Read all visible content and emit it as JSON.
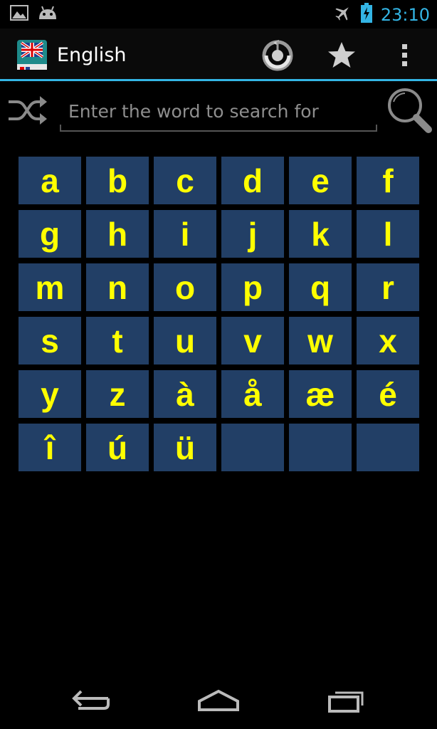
{
  "status_bar": {
    "time": "23:10",
    "icons": [
      "image-icon",
      "android-icon",
      "airplane-mode-icon",
      "battery-charging-icon"
    ]
  },
  "action_bar": {
    "title": "English",
    "app_icon": "dictionary-flag-icon",
    "actions": [
      "history-icon",
      "star-icon",
      "overflow-menu-icon"
    ]
  },
  "search": {
    "placeholder": "Enter the word to search for",
    "value": "",
    "left_icon": "shuffle-icon",
    "right_icon": "search-icon"
  },
  "letters": [
    "a",
    "b",
    "c",
    "d",
    "e",
    "f",
    "g",
    "h",
    "i",
    "j",
    "k",
    "l",
    "m",
    "n",
    "o",
    "p",
    "q",
    "r",
    "s",
    "t",
    "u",
    "v",
    "w",
    "x",
    "y",
    "z",
    "à",
    "å",
    "æ",
    "é",
    "î",
    "ú",
    "ü",
    "",
    "",
    ""
  ],
  "nav_bar": [
    "back-icon",
    "home-icon",
    "recents-icon"
  ],
  "colors": {
    "accent": "#33b5e5",
    "tile": "#223f66",
    "letter": "#ffff00",
    "background": "#000000"
  }
}
